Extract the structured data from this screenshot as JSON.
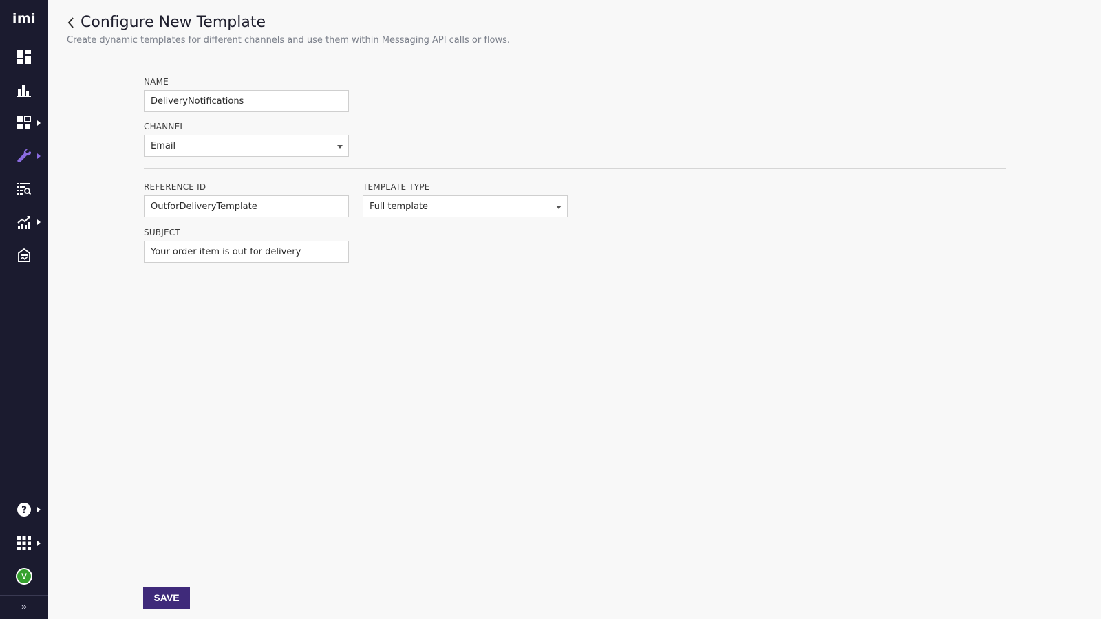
{
  "sidebar": {
    "logo": "imi",
    "nav_items": [
      {
        "icon": "dashboard-icon",
        "has_submenu": false,
        "active": false
      },
      {
        "icon": "bar-chart-icon",
        "has_submenu": false,
        "active": false
      },
      {
        "icon": "apps-grid-icon",
        "has_submenu": true,
        "active": false
      },
      {
        "icon": "wrench-icon",
        "has_submenu": true,
        "active": true
      },
      {
        "icon": "list-search-icon",
        "has_submenu": false,
        "active": false
      },
      {
        "icon": "trend-chart-icon",
        "has_submenu": true,
        "active": false
      },
      {
        "icon": "building-icon",
        "has_submenu": false,
        "active": false
      }
    ],
    "bottom_items": [
      {
        "icon": "help-icon",
        "has_submenu": true
      },
      {
        "icon": "app-launcher-icon",
        "has_submenu": true
      }
    ],
    "avatar_initial": "V",
    "expand_label": "»",
    "colors": {
      "background": "#1b1b2f",
      "icon": "#ffffff",
      "active_icon": "#8a6be0",
      "avatar": "#36a12f"
    }
  },
  "header": {
    "title": "Configure New Template",
    "subtitle": "Create dynamic templates for different channels and use them within Messaging API calls or flows."
  },
  "form": {
    "name": {
      "label": "NAME",
      "value": "DeliveryNotifications"
    },
    "channel": {
      "label": "CHANNEL",
      "value": "Email"
    },
    "reference_id": {
      "label": "REFERENCE ID",
      "value": "OutforDeliveryTemplate"
    },
    "template_type": {
      "label": "TEMPLATE TYPE",
      "value": "Full template"
    },
    "subject": {
      "label": "SUBJECT",
      "value": "Your order item is out for delivery"
    }
  },
  "footer": {
    "save_label": "SAVE",
    "save_color": "#3f2a7a"
  }
}
